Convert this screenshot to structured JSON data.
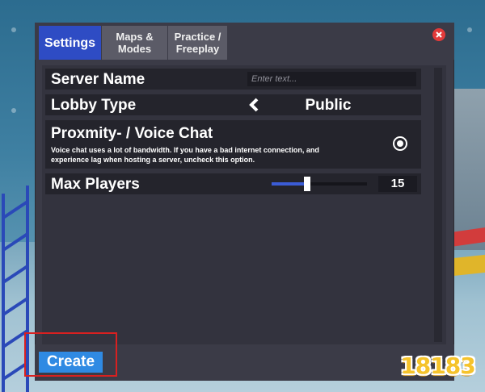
{
  "tabs": [
    {
      "label": "Settings",
      "active": true
    },
    {
      "label": "Maps &\nModes",
      "active": false
    },
    {
      "label": "Practice /\nFreeplay",
      "active": false
    }
  ],
  "settings": {
    "server_name": {
      "label": "Server Name",
      "placeholder": "Enter text...",
      "value": ""
    },
    "lobby_type": {
      "label": "Lobby Type",
      "value": "Public"
    },
    "voice_chat": {
      "label": "Proxmity- / Voice Chat",
      "description": "Voice chat uses a lot of bandwidth. If you have a bad internet connection, and experience lag when hosting a server, uncheck this option.",
      "checked": true
    },
    "max_players": {
      "label": "Max Players",
      "value": "15",
      "slider_fraction": 0.37
    }
  },
  "footer": {
    "create_label": "Create"
  },
  "watermark": {
    "text": "18183"
  },
  "icons": {
    "close": "close-icon",
    "lobby_prev": "chevron-left-icon"
  },
  "colors": {
    "tab_active": "#2e4cc4",
    "tab_inactive": "#5b5b67",
    "panel_bg": "#3b3b47",
    "row_bg": "#24242c",
    "create_button": "#2f8ae3",
    "close_button": "#e23a3a",
    "slider_fill": "#3b5cd6",
    "highlight": "#d92020"
  }
}
